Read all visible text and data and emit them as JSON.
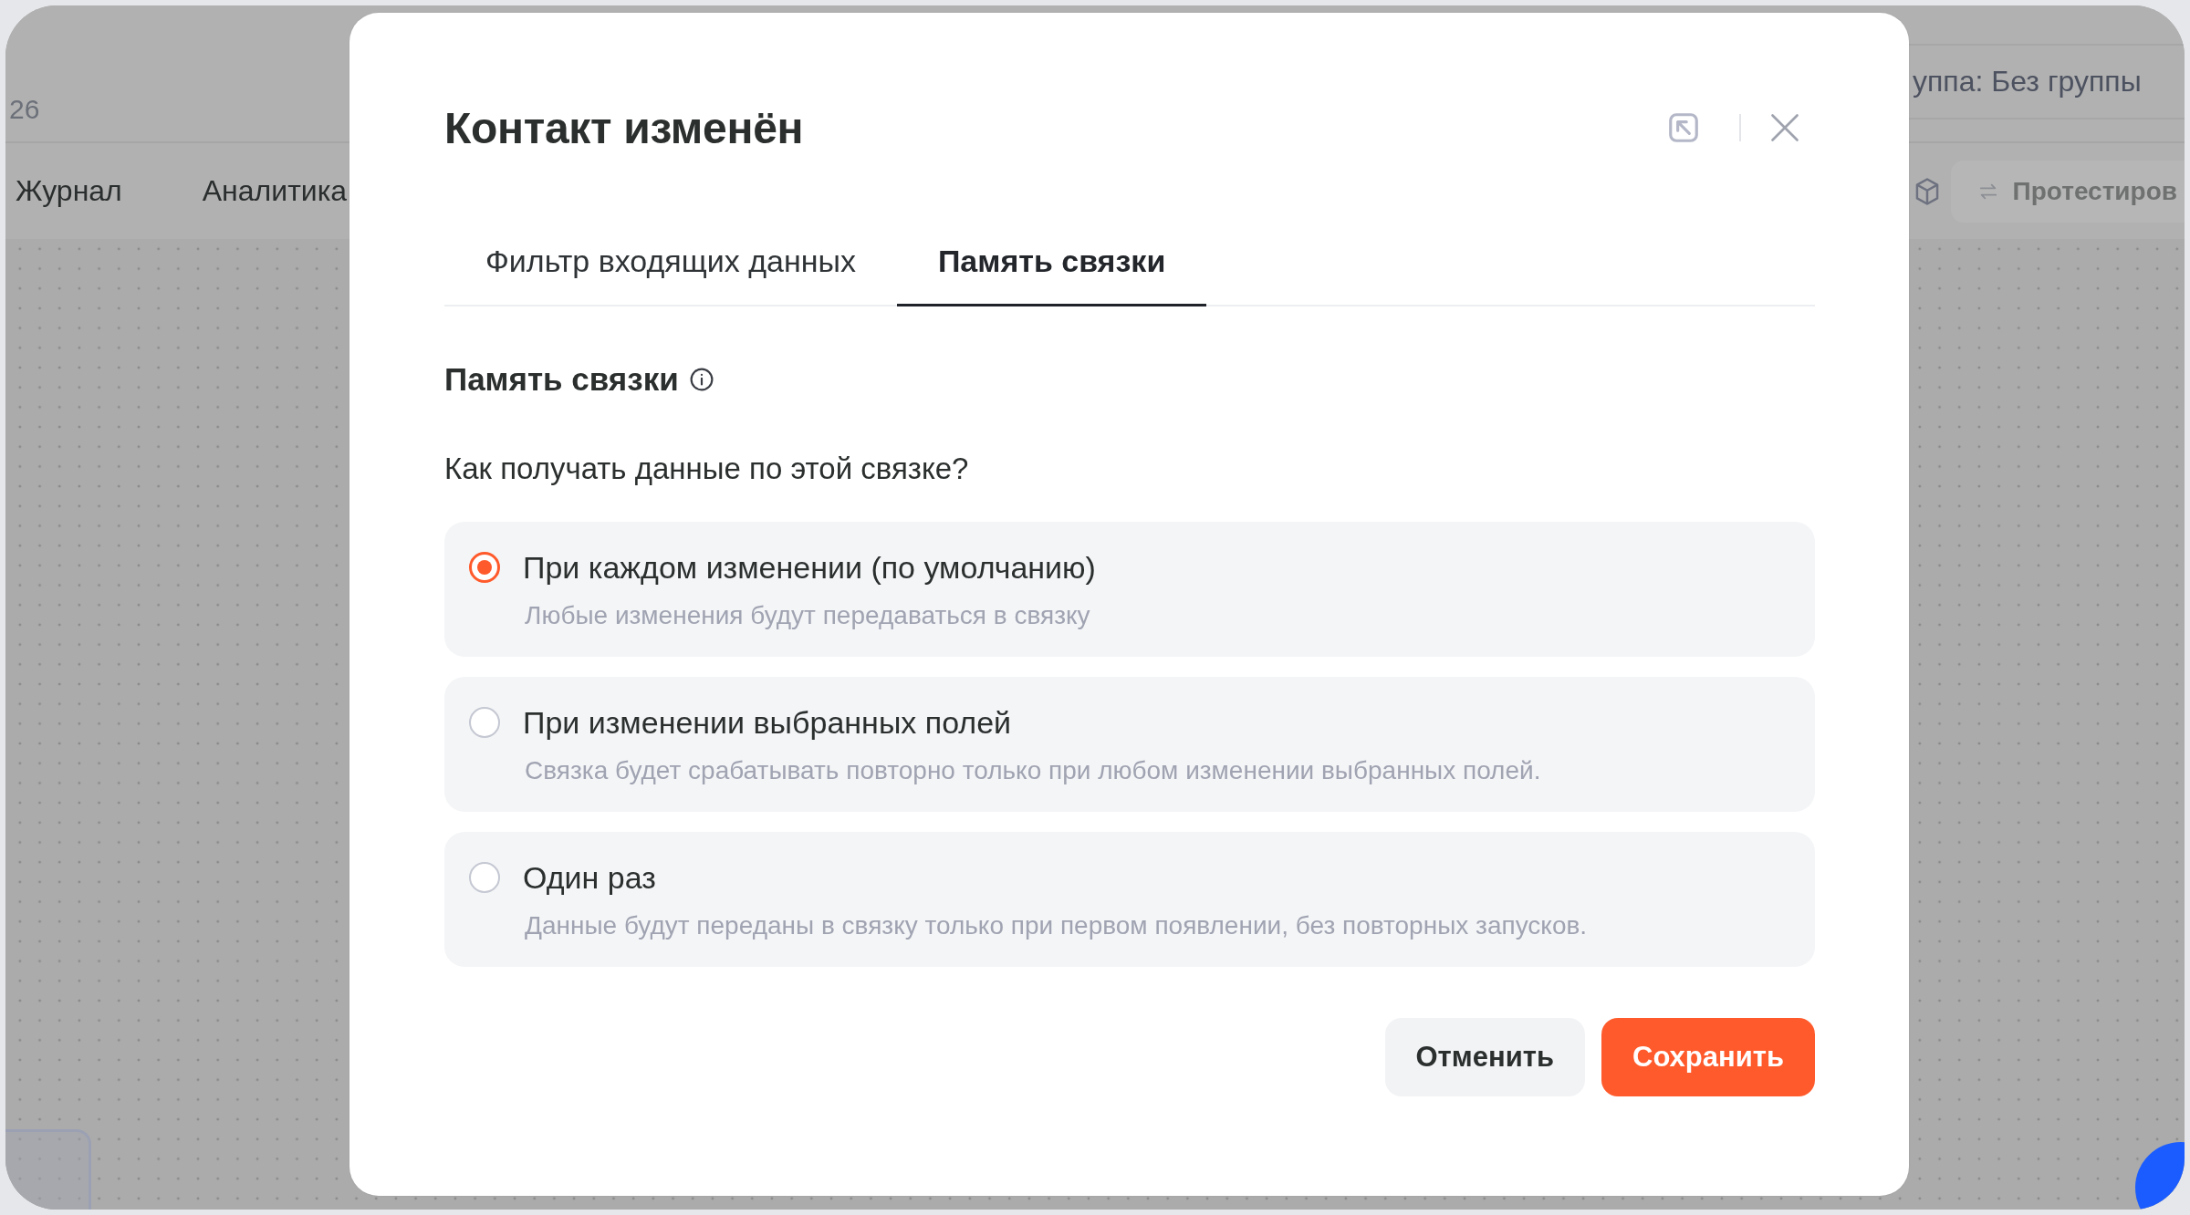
{
  "background": {
    "header_text": "26",
    "group_label": "уппа: Без группы",
    "nav_tabs": [
      {
        "label": "Журнал"
      },
      {
        "label": "Аналитика"
      }
    ],
    "test_button": {
      "label": "Протестиров"
    }
  },
  "dialog": {
    "title": "Контакт изменён",
    "tabs": [
      {
        "label": "Фильтр входящих данных",
        "selected": false
      },
      {
        "label": "Память связки",
        "selected": true
      }
    ],
    "section_title": "Память связки",
    "question": "Как получать данные по этой связке?",
    "options": [
      {
        "label": "При каждом изменении (по умолчанию)",
        "description": "Любые изменения будут передаваться в связку",
        "selected": true
      },
      {
        "label": "При изменении выбранных полей",
        "description": "Связка будет срабатывать повторно только при любом изменении выбранных полей.",
        "selected": false
      },
      {
        "label": "Один раз",
        "description": "Данные будут переданы в связку только при первом появлении, без повторных запусков.",
        "selected": false
      }
    ],
    "buttons": [
      {
        "label": "Отменить",
        "kind": "secondary"
      },
      {
        "label": "Сохранить",
        "kind": "primary"
      }
    ]
  }
}
